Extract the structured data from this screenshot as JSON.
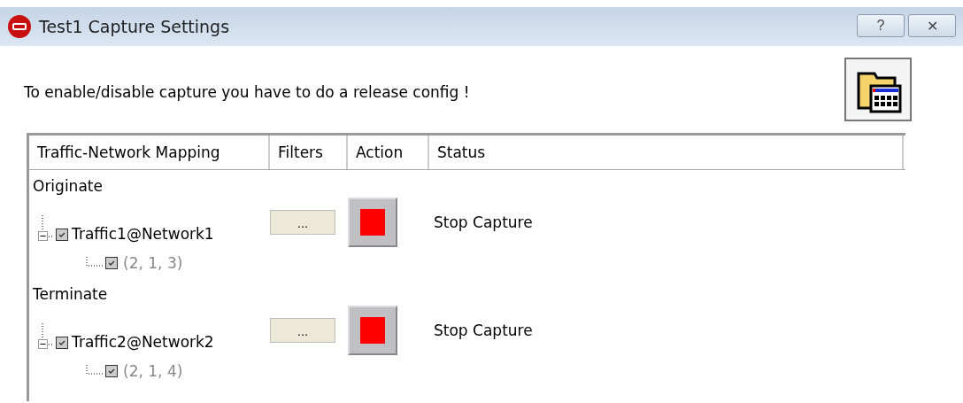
{
  "window": {
    "title": "Test1 Capture Settings",
    "buttons": [
      "?",
      "✕"
    ]
  },
  "notice": "To enable/disable capture you have to do a release config !",
  "table": {
    "columns": [
      "Traffic-Network Mapping",
      "Filters",
      "Action",
      "Status"
    ],
    "groups": [
      {
        "label": "Originate",
        "items": [
          {
            "label": "Traffic1@Network1",
            "expanded": true,
            "checked": true,
            "filter_button": "...",
            "status": "Stop Capture",
            "children": [
              {
                "label": "(2, 1, 3)",
                "checked": true,
                "disabled": true
              }
            ]
          }
        ]
      },
      {
        "label": "Terminate",
        "items": [
          {
            "label": "Traffic2@Network2",
            "expanded": true,
            "checked": true,
            "filter_button": "...",
            "status": "Stop Capture",
            "children": [
              {
                "label": "(2, 1, 4)",
                "checked": true,
                "disabled": true
              }
            ]
          }
        ]
      }
    ]
  }
}
